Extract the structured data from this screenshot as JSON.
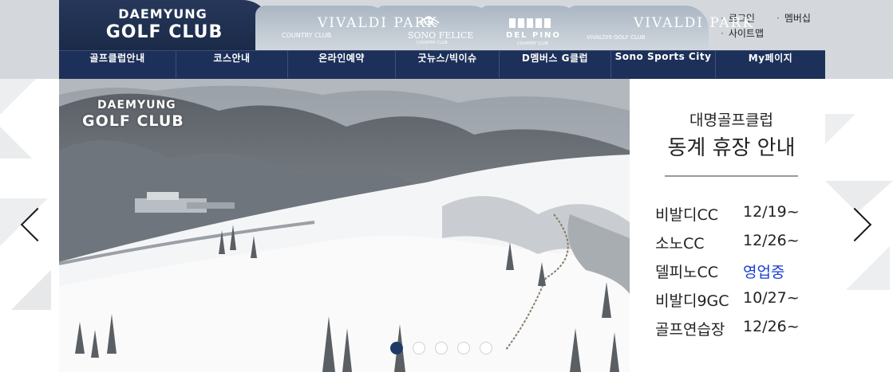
{
  "brand": {
    "line1": "DAEMYUNG",
    "line2": "GOLF CLUB"
  },
  "club_tabs": [
    {
      "small": "COUNTRY CLUB",
      "big": "VIVALDI PARK"
    },
    {
      "big": "SONO FELICE",
      "small": "COUNTRY CLUB"
    },
    {
      "big": "DEL PINO",
      "small": "COUNTRY CLUB"
    },
    {
      "small": "VIVALDI9 GOLF CLUB",
      "big": "VIVALDI PARK"
    }
  ],
  "utility": {
    "login": "로그인",
    "membership": "멤버십",
    "sitemap": "사이트맵"
  },
  "gnb": [
    "골프클럽안내",
    "코스안내",
    "온라인예약",
    "굿뉴스/빅이슈",
    "D멤버스 G클럽",
    "Sono Sports City",
    "My페이지"
  ],
  "hero": {
    "logo_line1": "DAEMYUNG",
    "logo_line2": "GOLF CLUB"
  },
  "slider": {
    "slide_count": 5,
    "active_index": 0,
    "prev_icon": "chevron-left-icon",
    "next_icon": "chevron-right-icon"
  },
  "notice": {
    "subtitle": "대명골프클럽",
    "title": "동계 휴장 안내",
    "rows": [
      {
        "course": "비발디CC",
        "date": "12/19~"
      },
      {
        "course": "소노CC",
        "date": "12/26~"
      },
      {
        "course": "델피노CC",
        "date": "영업중",
        "highlight": true
      },
      {
        "course": "비발디9GC",
        "date": "10/27~"
      },
      {
        "course": "골프연습장",
        "date": "12/26~"
      }
    ]
  },
  "colors": {
    "navy": "#1d3059",
    "highlight": "#1a3fd4",
    "header_bg": "#d4d8dd",
    "tab_silver": "#b8c2cc"
  }
}
